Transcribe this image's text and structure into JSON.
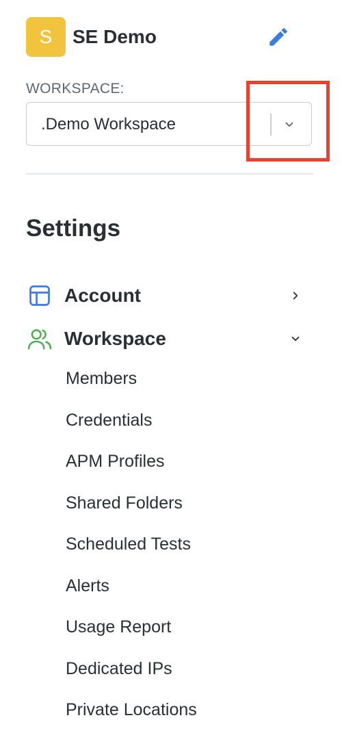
{
  "org": {
    "avatar_letter": "S",
    "name": "SE Demo",
    "avatar_color": "#f2c43d",
    "edit_icon": "pencil-icon"
  },
  "workspace": {
    "label": "WORKSPACE:",
    "selected": ".Demo Workspace",
    "dropdown_icon": "chevron-down-icon"
  },
  "settings": {
    "title": "Settings",
    "items": [
      {
        "label": "Account",
        "icon": "layout-icon",
        "icon_color": "#3b7ddd",
        "expanded": false
      },
      {
        "label": "Workspace",
        "icon": "users-icon",
        "icon_color": "#4caf50",
        "expanded": true
      }
    ],
    "workspace_subitems": [
      "Members",
      "Credentials",
      "APM Profiles",
      "Shared Folders",
      "Scheduled Tests",
      "Alerts",
      "Usage Report",
      "Dedicated IPs",
      "Private Locations"
    ]
  },
  "annotation": {
    "highlight_color": "#e8412f"
  }
}
